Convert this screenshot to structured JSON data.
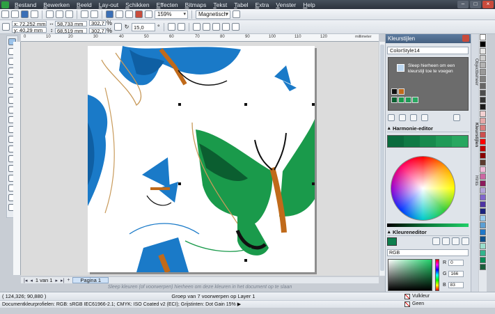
{
  "menu": {
    "items": [
      "Bestand",
      "Bewerken",
      "Beeld",
      "Lay-out",
      "Schikken",
      "Effecten",
      "Bitmaps",
      "Tekst",
      "Tabel",
      "Extra",
      "Venster",
      "Help"
    ]
  },
  "standard_toolbar": {
    "zoom": "159%",
    "snap": "Magnetisch"
  },
  "property_bar": {
    "x": "x: 72,252 mm",
    "y": "y: 40,29 mm",
    "width": "58,733 mm",
    "height": "68,519 mm",
    "scale_x": "302,7",
    "scale_y": "302,7",
    "percent": "%",
    "rotation": "15,0",
    "degree": "°"
  },
  "ruler": {
    "ticks": [
      "0",
      "10",
      "20",
      "30",
      "40",
      "50",
      "60",
      "70",
      "80",
      "90",
      "100",
      "110",
      "120"
    ],
    "unit": "millimeter"
  },
  "page_nav": {
    "counter": "1 van 1",
    "page_tab": "Pagina 1"
  },
  "canvas_hint": "Sleep kleuren (of voorwerpen) hierheen om deze kleuren in het document op te slaan",
  "docker": {
    "title": "Kleurstijlen",
    "color_style": "ColorStyle14",
    "drop_hint": "Sleep hierheen om een kleurstijl toe te voegen",
    "harmony_title": "Harmonie-editor",
    "harmony_colors": [
      "#0a6b3d",
      "#0f7a45",
      "#178a4d",
      "#1f9a57",
      "#28a760"
    ],
    "color_editor_title": "Kleureneditor",
    "color_model": "RGB",
    "r_label": "R",
    "r_value": "0",
    "g_label": "G",
    "g_value": "166",
    "b_label": "B",
    "b_value": "83"
  },
  "side_tabs": [
    "Objectbeheer",
    "Kleurstijlen",
    "Hints"
  ],
  "palette": [
    "#ffffff",
    "#000000",
    "#e6e6e6",
    "#cccccc",
    "#b3b3b3",
    "#999999",
    "#808080",
    "#666666",
    "#4d4d4d",
    "#333333",
    "#1a1a1a",
    "#f2d1d1",
    "#e5a8a8",
    "#d97c7c",
    "#cc4f4f",
    "#ff0000",
    "#c00000",
    "#8a0000",
    "#5c3a2e",
    "#f2b9d9",
    "#cc66a3",
    "#8c1a5c",
    "#b3a3d9",
    "#8066cc",
    "#4d33a3",
    "#1a237e",
    "#99ccee",
    "#5c9fd4",
    "#1f77c9",
    "#0d4f8b",
    "#99ddcc",
    "#33b38c",
    "#0a8a55",
    "#1a5c3a"
  ],
  "status": {
    "coords": "( 124,326; 90,880 )",
    "selection": "Groep van 7 voorwerpen op Layer 1",
    "profiles": "Documentkleurprofielen: RGB: sRGB IEC61966-2.1; CMYK: ISO Coated v2 (ECI); Grijstinten: Dot Gain 15% ▶",
    "fill_label": "Vulkleur",
    "outline_label": "Geen"
  }
}
